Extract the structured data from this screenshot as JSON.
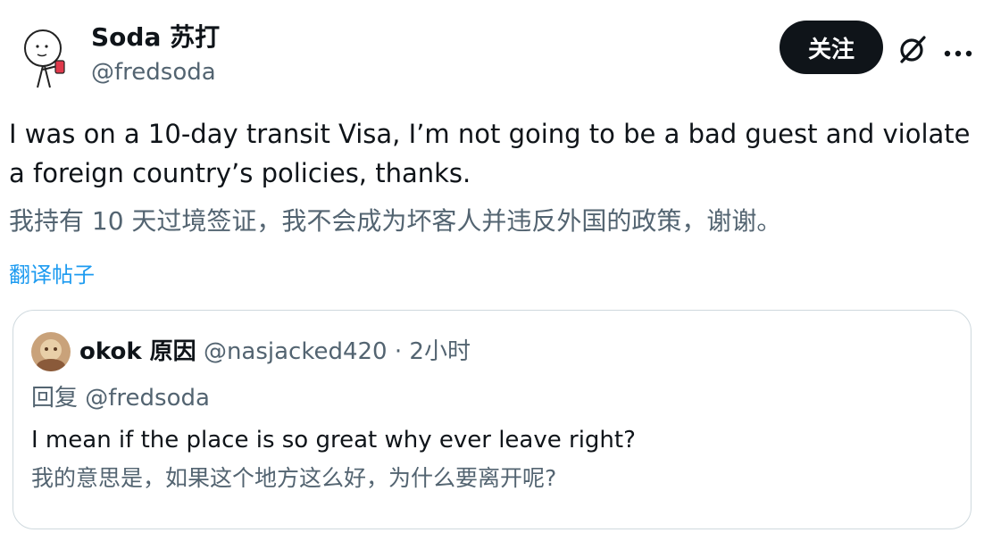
{
  "author": {
    "display_name": "Soda 苏打",
    "handle": "@fredsoda",
    "avatar_icon": "stick-figure-avatar"
  },
  "header_actions": {
    "follow_label": "关注",
    "grok_icon": "slashed-circle-icon",
    "more_icon": "more-dots-icon"
  },
  "post": {
    "text": "I was on a 10-day transit Visa, I’m not going to be a bad guest and violate a foreign country’s policies, thanks.",
    "translation": "我持有 10 天过境签证，我不会成为坏客人并违反外国的政策，谢谢。",
    "translate_link": "翻译帖子"
  },
  "quoted_post": {
    "display_name": "okok 原因",
    "handle": "@nasjacked420",
    "separator": "·",
    "time": "2小时",
    "reply_prefix": "回复",
    "reply_handle": "@fredsoda",
    "text": "I mean if the place is so great why ever leave right?",
    "translation": "我的意思是，如果这个地方这么好，为什么要离开呢?"
  },
  "colors": {
    "text_primary": "#0f1419",
    "text_secondary": "#536471",
    "link": "#1d9bf0",
    "border": "#cfd9de",
    "button_bg": "#0f1419"
  }
}
